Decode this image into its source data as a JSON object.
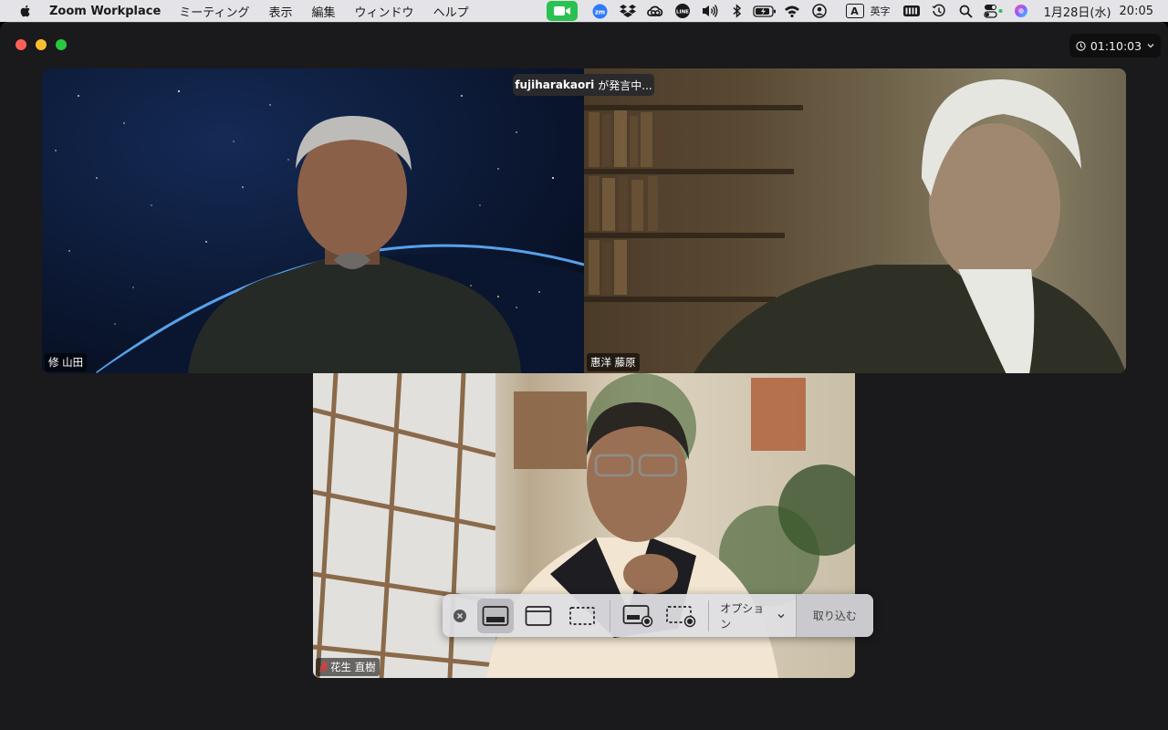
{
  "menubar": {
    "app_name": "Zoom Workplace",
    "items": [
      "ミーティング",
      "表示",
      "編集",
      "ウィンドウ",
      "ヘルプ"
    ],
    "tray_icons": [
      "zoom-video-icon",
      "zoom-app-icon",
      "dropbox-icon",
      "creative-cloud-icon",
      "line-icon",
      "volume-icon",
      "bluetooth-icon",
      "battery-icon",
      "wifi-icon",
      "user-icon"
    ],
    "ime_letter": "A",
    "ime_label": "英字",
    "date": "1月28日(水)",
    "time": "20:05"
  },
  "window": {
    "timer": "01:10:03",
    "speaking_name": "fujiharakaori",
    "speaking_suffix": "が発言中...",
    "participants": [
      {
        "name": "修 山田",
        "muted": false
      },
      {
        "name": "惠洋 藤原",
        "muted": false
      },
      {
        "name": "花生 直樹",
        "muted": true
      }
    ]
  },
  "toolbar": {
    "options_label": "オプション",
    "capture_label": "取り込む",
    "buttons": [
      "capture-entire-screen",
      "capture-window",
      "capture-selection",
      "record-entire-screen",
      "record-selection"
    ]
  },
  "colors": {
    "menubar_bg": "#e4e4e8",
    "window_bg": "#1a1a1c",
    "zoom_green": "#2bc150",
    "muted_red": "#e23b3b"
  }
}
